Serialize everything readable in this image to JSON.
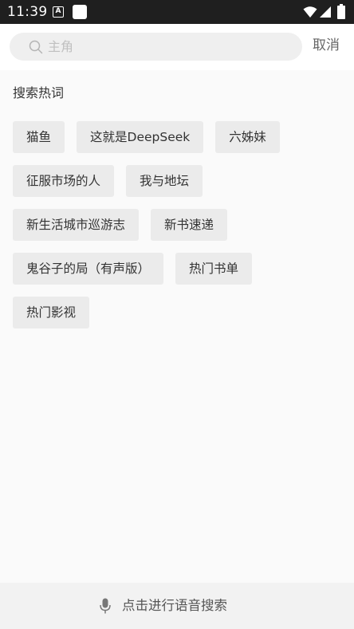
{
  "status_bar": {
    "time": "11:39",
    "notification_icon_letter": "A",
    "icons": [
      "notification-a-icon",
      "app-square-icon",
      "wifi-icon",
      "signal-icon",
      "battery-icon"
    ]
  },
  "search": {
    "placeholder": "主角",
    "value": "",
    "cancel_label": "取消"
  },
  "hot_section": {
    "title": "搜索热词",
    "rows": [
      [
        "猫鱼",
        "这就是DeepSeek",
        "六姊妹"
      ],
      [
        "征服市场的人",
        "我与地坛"
      ],
      [
        "新生活城市巡游志",
        "新书速递"
      ],
      [
        "鬼谷子的局（有声版）",
        "热门书单"
      ],
      [
        "热门影视"
      ]
    ]
  },
  "voice_search": {
    "label": "点击进行语音搜索",
    "icon": "microphone-icon"
  },
  "colors": {
    "status_bar_bg": "#1f1f1f",
    "page_bg": "#fafafa",
    "tag_bg": "#ebebeb",
    "search_bg": "#efefef"
  }
}
